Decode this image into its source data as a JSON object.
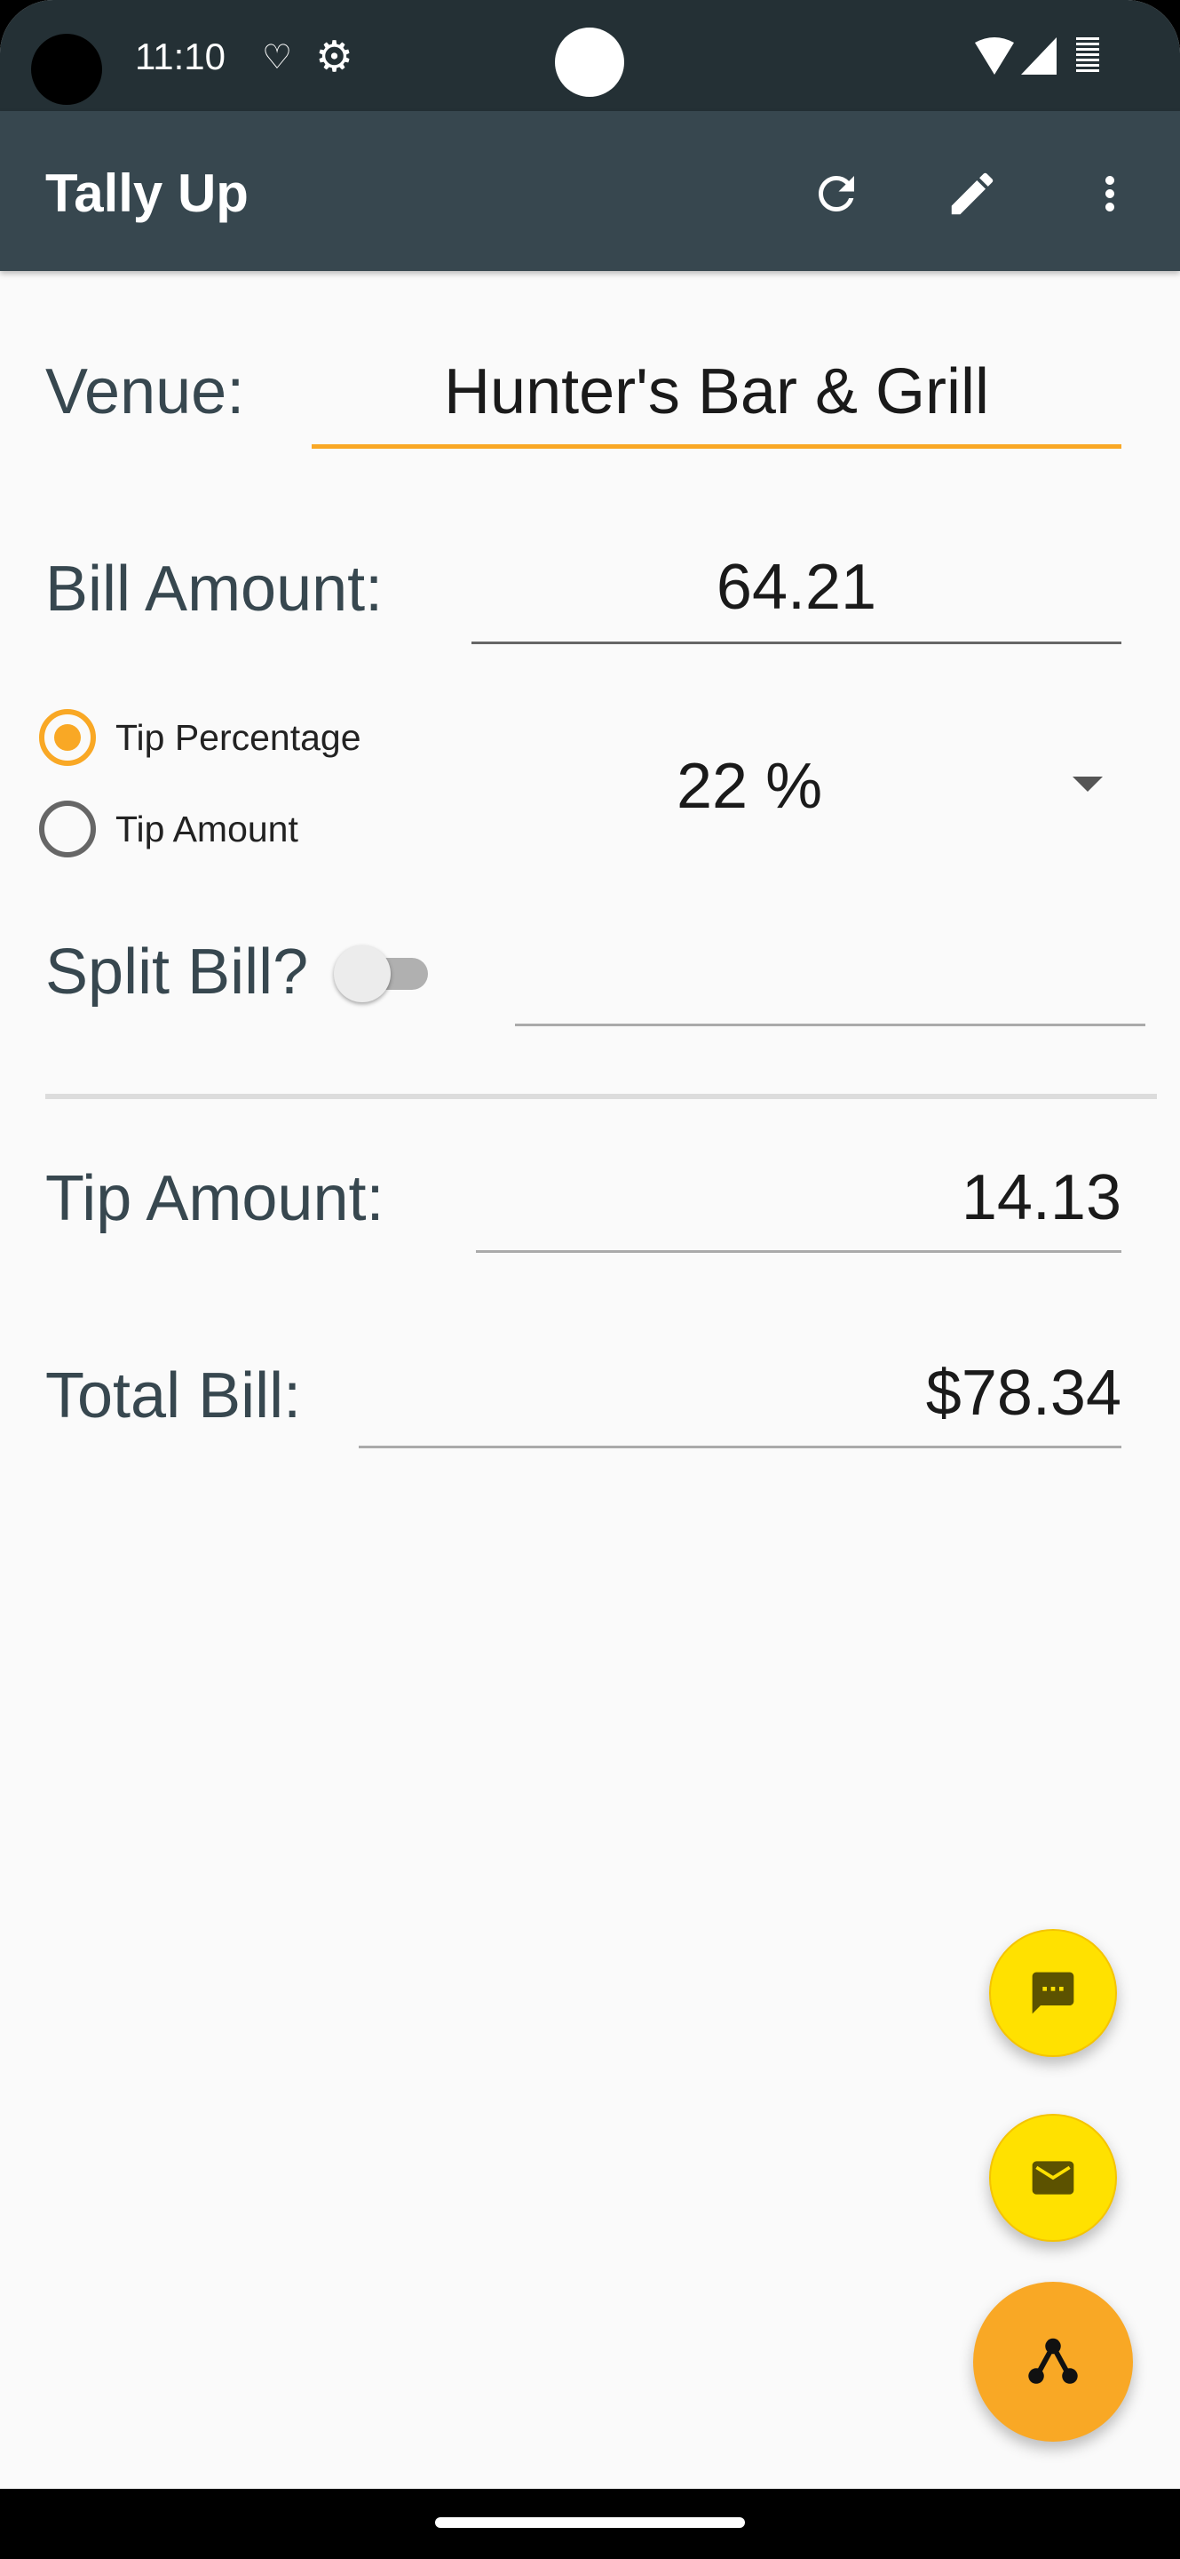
{
  "status_bar": {
    "time": "11:10"
  },
  "app_bar": {
    "title": "Tally Up",
    "actions": [
      "refresh-icon",
      "edit-icon",
      "more-vert-icon"
    ]
  },
  "form": {
    "venue": {
      "label": "Venue:",
      "value": "Hunter's Bar & Grill"
    },
    "bill_amount": {
      "label": "Bill Amount:",
      "value": "64.21"
    },
    "tip_mode": {
      "options": [
        "Tip Percentage",
        "Tip Amount"
      ],
      "selected": "Tip Percentage"
    },
    "tip_percentage": {
      "value": "22 %"
    },
    "split_bill": {
      "label": "Split Bill?",
      "enabled": false,
      "value": ""
    },
    "tip_amount": {
      "label": "Tip Amount:",
      "value": "14.13"
    },
    "total_bill": {
      "label": "Total Bill:",
      "value": "$78.34"
    }
  },
  "fabs": [
    "sms-icon",
    "email-icon",
    "share-icon"
  ],
  "colors": {
    "status_bar": "#243035",
    "app_bar": "#37474f",
    "accent": "#f9a825",
    "fab_secondary": "#ffe100",
    "background": "#fafafa"
  }
}
